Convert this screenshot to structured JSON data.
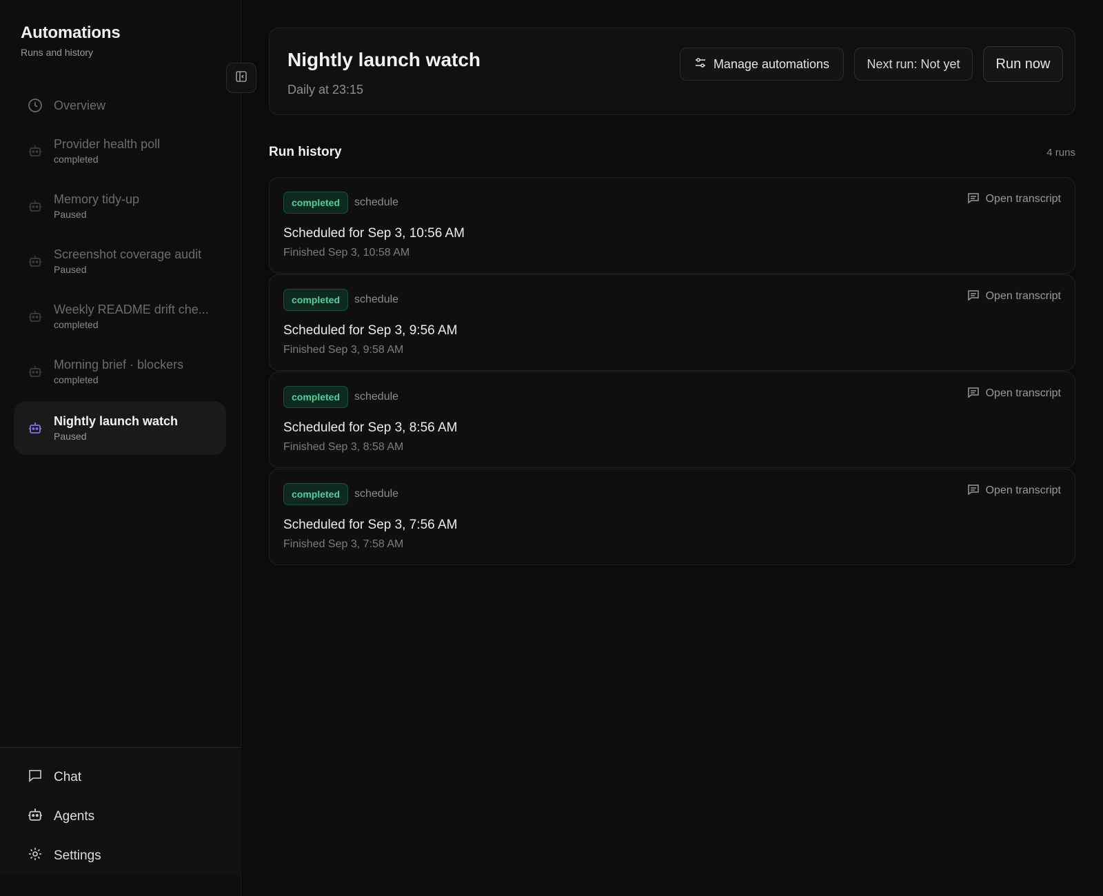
{
  "sidebar": {
    "title": "Automations",
    "subtitle": "Runs and history",
    "collapse_icon": "sidebar-collapse-icon",
    "overview": {
      "label": "Overview",
      "icon": "clock-icon"
    },
    "automations": [
      {
        "label": "Provider health poll",
        "status": "completed",
        "icon": "bot-icon"
      },
      {
        "label": "Memory tidy-up",
        "status": "Paused",
        "icon": "bot-icon"
      },
      {
        "label": "Screenshot coverage audit",
        "status": "Paused",
        "icon": "bot-icon"
      },
      {
        "label": "Weekly README drift che...",
        "status": "completed",
        "icon": "bot-icon"
      },
      {
        "label": "Morning brief · blockers",
        "status": "completed",
        "icon": "bot-icon"
      },
      {
        "label": "Nightly launch watch",
        "status": "Paused",
        "icon": "bot-icon",
        "active": true
      }
    ],
    "bottom": [
      {
        "label": "Chat",
        "icon": "chat-icon"
      },
      {
        "label": "Agents",
        "icon": "bot-icon"
      },
      {
        "label": "Settings",
        "icon": "gear-icon"
      }
    ]
  },
  "header": {
    "title": "Nightly launch watch",
    "schedule": "Daily at 23:15",
    "manage_label": "Manage automations",
    "manage_icon": "sliders-icon",
    "next_run_label": "Next run: Not yet",
    "run_now_label": "Run now"
  },
  "history": {
    "title": "Run history",
    "count": "4 runs",
    "transcript_label": "Open transcript",
    "runs": [
      {
        "status": "completed",
        "trigger": "schedule",
        "scheduled": "Scheduled for Sep 3, 10:56 AM",
        "finished": "Finished Sep 3, 10:58 AM"
      },
      {
        "status": "completed",
        "trigger": "schedule",
        "scheduled": "Scheduled for Sep 3, 9:56 AM",
        "finished": "Finished Sep 3, 9:58 AM"
      },
      {
        "status": "completed",
        "trigger": "schedule",
        "scheduled": "Scheduled for Sep 3, 8:56 AM",
        "finished": "Finished Sep 3, 8:58 AM"
      },
      {
        "status": "completed",
        "trigger": "schedule",
        "scheduled": "Scheduled for Sep 3, 7:56 AM",
        "finished": "Finished Sep 3, 7:58 AM"
      }
    ]
  },
  "colors": {
    "background": "#0b0b0b",
    "sidebar": "#0e0e0e",
    "accent_active_icon": "#8b6cf6",
    "success": "#4fd29a"
  }
}
